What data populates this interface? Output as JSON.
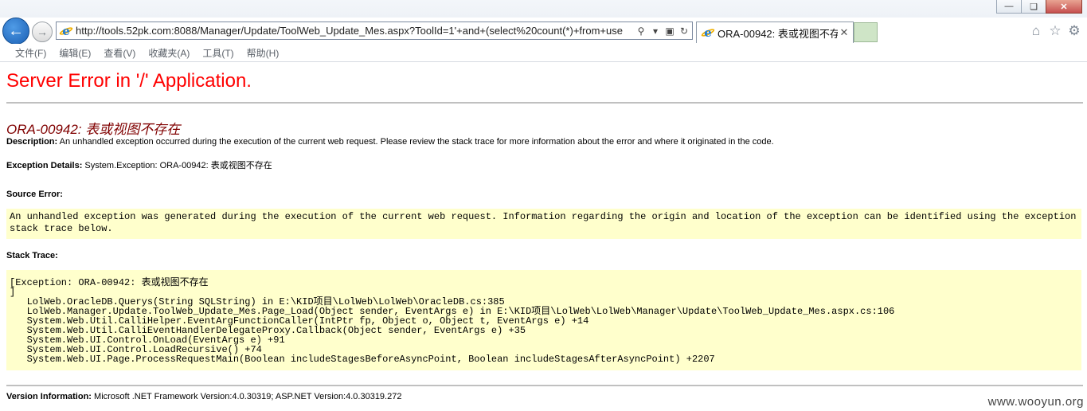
{
  "browser": {
    "address_url": "http://tools.52pk.com:8088/Manager/Update/ToolWeb_Update_Mes.aspx?ToolId=1'+and+(select%20count(*)+from+use",
    "tab_title": "ORA-00942: 表或视图不存...",
    "menu": [
      "文件(F)",
      "编辑(E)",
      "查看(V)",
      "收藏夹(A)",
      "工具(T)",
      "帮助(H)"
    ]
  },
  "page": {
    "title": "Server Error in '/' Application.",
    "error_heading": "ORA-00942: 表或视图不存在",
    "description_label": "Description:",
    "description_text": " An unhandled exception occurred during the execution of the current web request. Please review the stack trace for more information about the error and where it originated in the code.",
    "exception_label": "Exception Details:",
    "exception_text": " System.Exception: ORA-00942: 表或视图不存在",
    "source_error_label": "Source Error:",
    "source_error_text": "An unhandled exception was generated during the execution of the current web request. Information regarding the origin and location of the exception can be identified using the exception stack trace below.",
    "stack_trace_label": "Stack Trace:",
    "stack_trace": [
      "[Exception: ORA-00942: 表或视图不存在",
      "]",
      "   LolWeb.OracleDB.Querys(String SQLString) in E:\\KID项目\\LolWeb\\LolWeb\\OracleDB.cs:385",
      "   LolWeb.Manager.Update.ToolWeb_Update_Mes.Page_Load(Object sender, EventArgs e) in E:\\KID项目\\LolWeb\\LolWeb\\Manager\\Update\\ToolWeb_Update_Mes.aspx.cs:106",
      "   System.Web.Util.CalliHelper.EventArgFunctionCaller(IntPtr fp, Object o, Object t, EventArgs e) +14",
      "   System.Web.Util.CalliEventHandlerDelegateProxy.Callback(Object sender, EventArgs e) +35",
      "   System.Web.UI.Control.OnLoad(EventArgs e) +91",
      "   System.Web.UI.Control.LoadRecursive() +74",
      "   System.Web.UI.Page.ProcessRequestMain(Boolean includeStagesBeforeAsyncPoint, Boolean includeStagesAfterAsyncPoint) +2207"
    ],
    "version_label": "Version Information:",
    "version_text": " Microsoft .NET Framework Version:4.0.30319; ASP.NET Version:4.0.30319.272"
  },
  "watermark": "www.wooyun.org",
  "colors": {
    "title_red": "#ff0000",
    "heading_maroon": "#800000",
    "code_box_bg": "#ffffcc"
  },
  "icons": [
    "back-arrow-icon",
    "forward-arrow-icon",
    "ie-logo-icon",
    "search-icon",
    "dropdown-icon",
    "compat-view-icon",
    "refresh-icon",
    "close-tab-icon",
    "home-icon",
    "favorites-star-icon",
    "settings-gear-icon",
    "minimize-icon",
    "restore-icon",
    "close-window-icon"
  ]
}
